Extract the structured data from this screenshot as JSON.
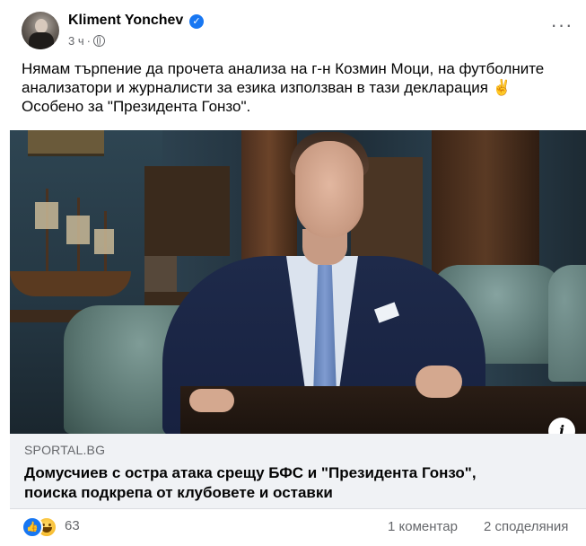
{
  "post": {
    "author": "Kliment Yonchev",
    "time": "3 ч",
    "text_line1": "Нямам търпение да прочета анализа на г-н Козмин Моци, на футболните",
    "text_line2": "анализатори и журналисти за езика използван в тази декларация ✌️",
    "text_line3": "Особено за \"Президента Гонзо\"."
  },
  "link": {
    "source": "SPORTAL.BG",
    "title_line1": "Домусчиев с остра атака срещу БФС и \"Президента Гонзо\",",
    "title_line2": "поиска подкрепа от клубовете и оставки"
  },
  "footer": {
    "reaction_count": "63",
    "comments": "1 коментар",
    "shares": "2 споделяния"
  },
  "icons": {
    "verified": "verified-badge-icon",
    "privacy": "globe-icon",
    "more": "more-options-icon",
    "info": "info-icon",
    "reactions": [
      "like-icon",
      "haha-icon"
    ]
  },
  "colors": {
    "accent": "#1877f2",
    "secondary_text": "#65676b",
    "link_bg": "#f0f2f5"
  }
}
